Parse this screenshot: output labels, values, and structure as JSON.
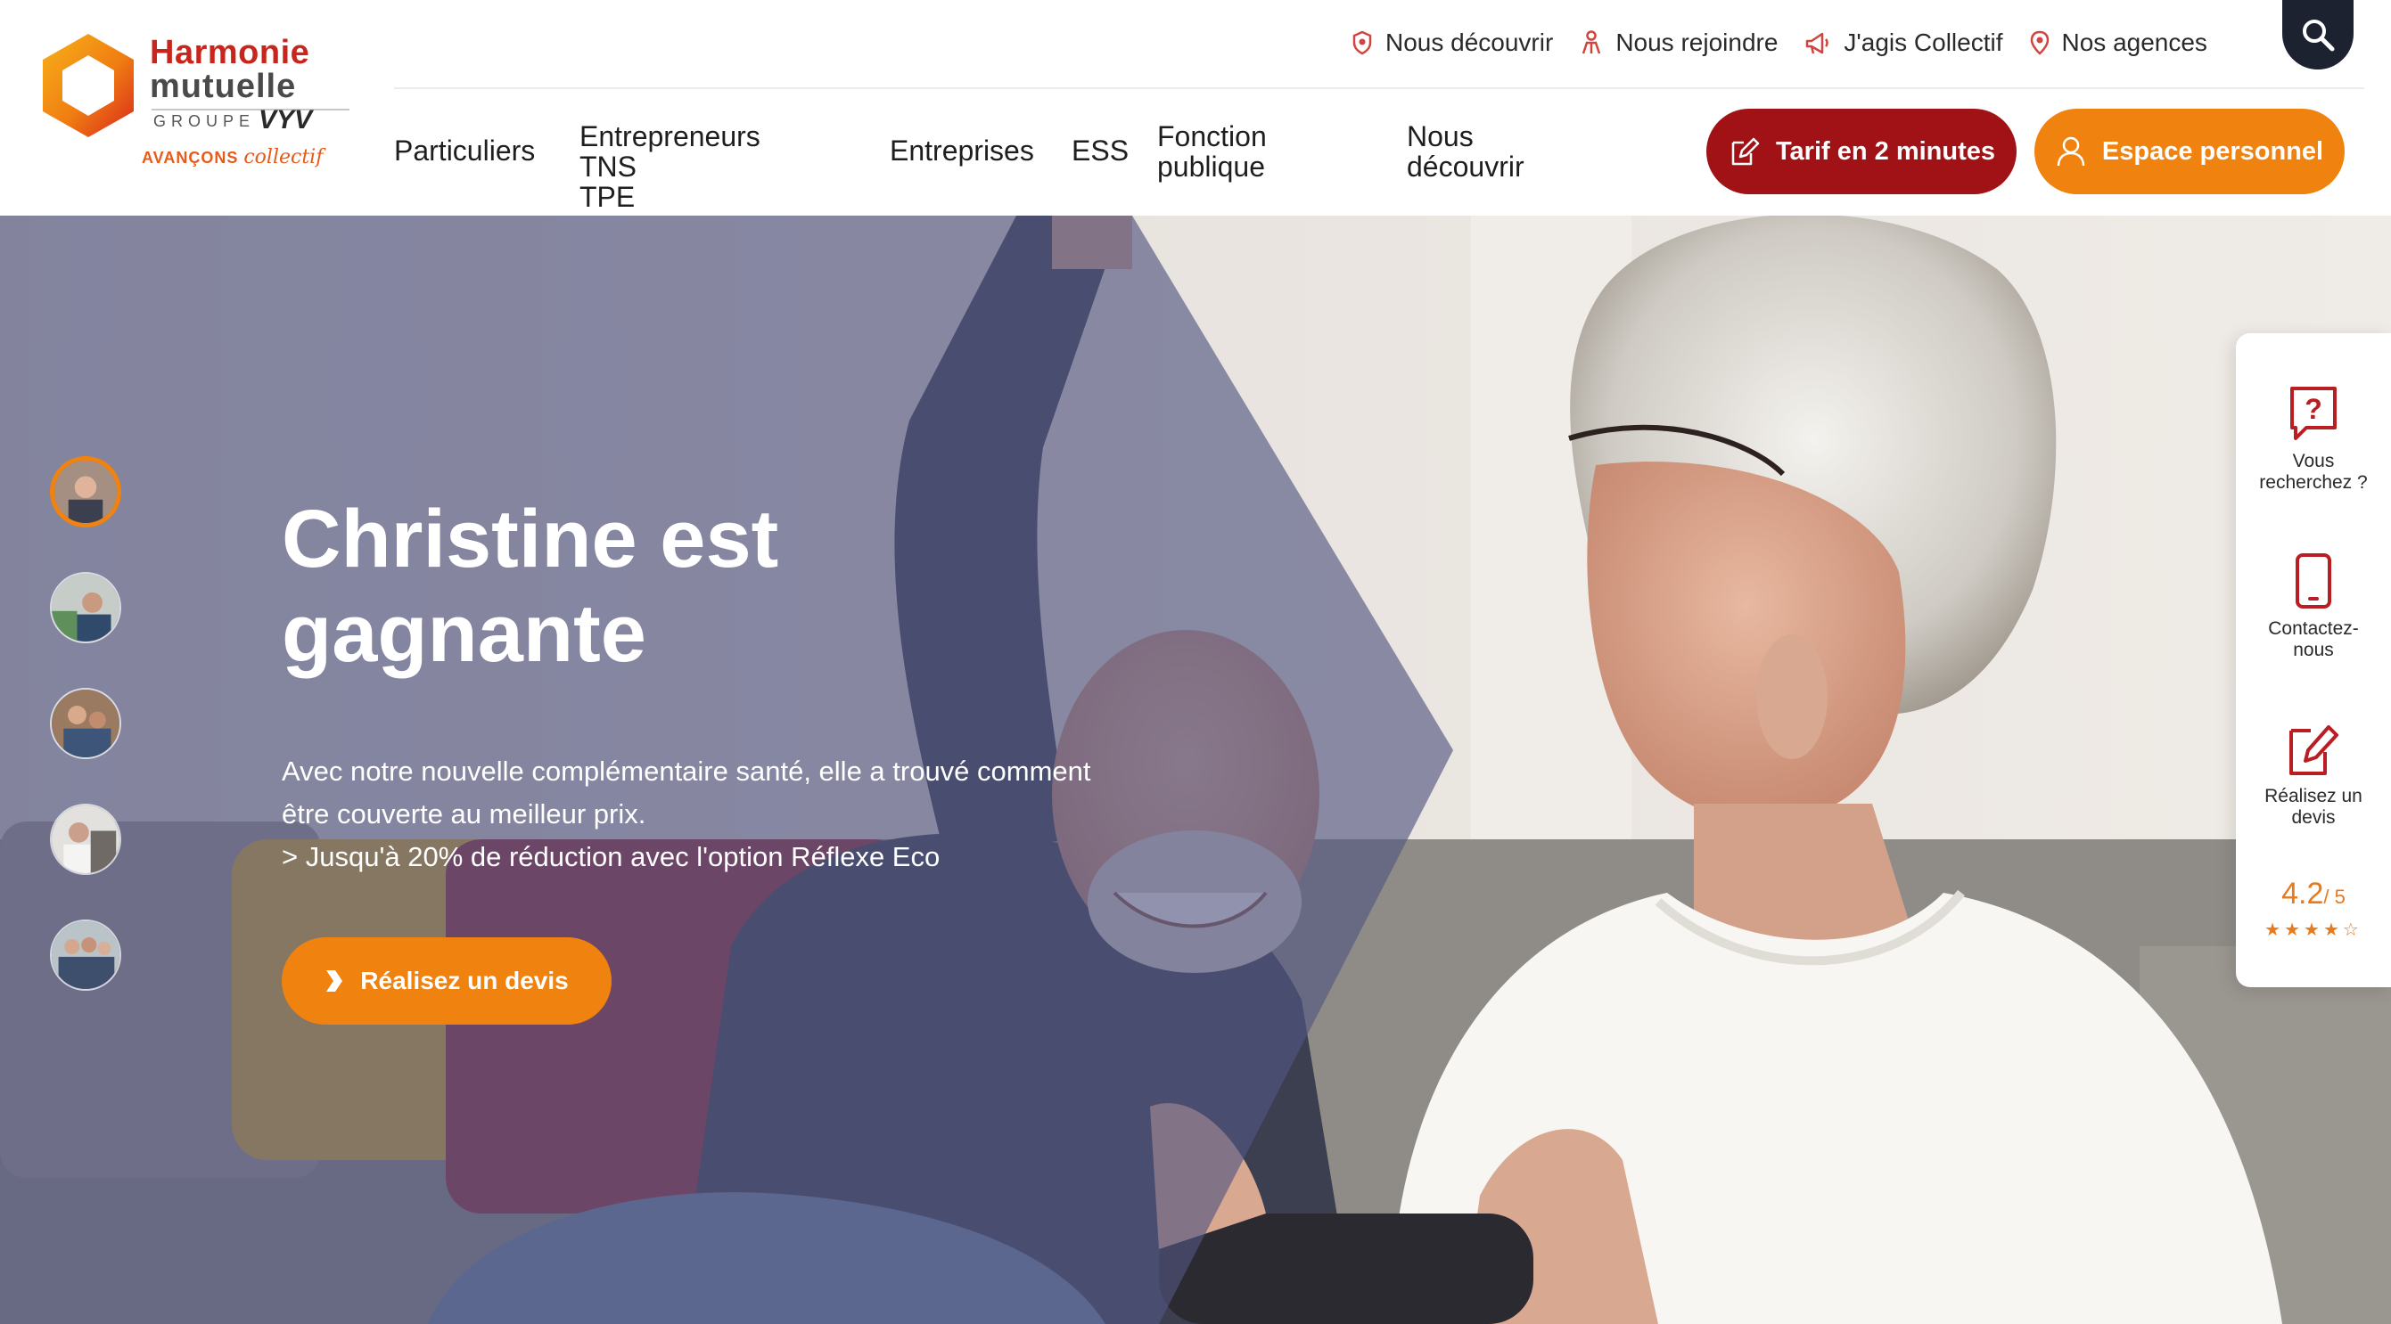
{
  "brand": {
    "name_line1": "Harmonie",
    "name_line2": "mutuelle",
    "group_label": "GROUPE",
    "group_name": "VYV",
    "tagline": "AVANÇONS",
    "tagline_script": "collectif"
  },
  "top_nav": [
    {
      "label": "Nous découvrir",
      "icon": "shield-icon"
    },
    {
      "label": "Nous rejoindre",
      "icon": "person-icon"
    },
    {
      "label": "J'agis Collectif",
      "icon": "megaphone-icon"
    },
    {
      "label": "Nos agences",
      "icon": "location-pin-icon"
    }
  ],
  "main_nav": {
    "particuliers": "Particuliers",
    "entrepreneurs_l1": "Entrepreneurs TNS",
    "entrepreneurs_l2": "TPE",
    "entreprises": "Entreprises",
    "ess": "ESS",
    "fonction_l1": "Fonction",
    "fonction_l2": "publique",
    "decouvrir_l1": "Nous",
    "decouvrir_l2": "découvrir"
  },
  "buttons": {
    "tarif": "Tarif en 2 minutes",
    "espace": "Espace personnel"
  },
  "hero": {
    "title_l1": "Christine est",
    "title_l2": "gagnante",
    "desc_l1": "Avec notre nouvelle complémentaire santé, elle a trouvé comment",
    "desc_l2": "être couverte au meilleur prix.",
    "desc_l3": "> Jusqu'à 20% de réduction avec l'option Réflexe Eco",
    "cta": "Réalisez un devis"
  },
  "side_panel": {
    "search_l1": "Vous",
    "search_l2": "recherchez ?",
    "contact_l1": "Contactez-",
    "contact_l2": "nous",
    "devis_l1": "Réalisez un",
    "devis_l2": "devis",
    "rating_value": "4.2",
    "rating_max": "/ 5",
    "rating_stars": 4.2
  },
  "colors": {
    "brand_red": "#a01215",
    "brand_orange": "#f0820f",
    "dark_navy": "#1c2230"
  }
}
